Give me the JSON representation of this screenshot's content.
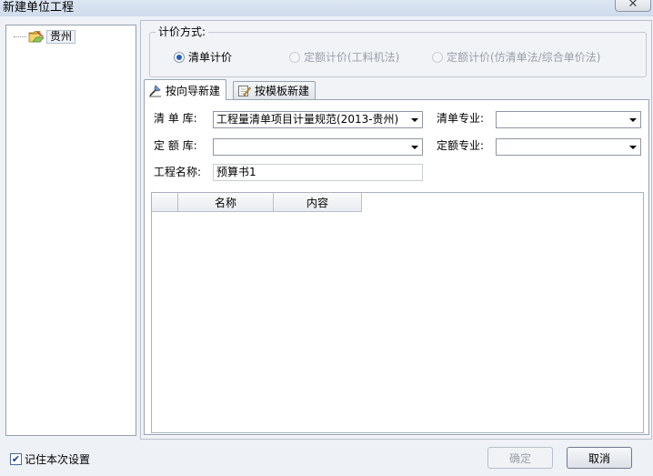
{
  "window": {
    "title": "新建单位工程",
    "close_glyph": "✕"
  },
  "tree": {
    "items": [
      {
        "label": "贵州",
        "icon": "folder-icon"
      }
    ]
  },
  "pricing": {
    "legend": "计价方式:",
    "options": [
      {
        "label": "清单计价",
        "checked": true,
        "enabled": true
      },
      {
        "label": "定额计价(工料机法)",
        "checked": false,
        "enabled": false
      },
      {
        "label": "定额计价(仿清单法/综合单价法)",
        "checked": false,
        "enabled": false
      }
    ]
  },
  "tabs": [
    {
      "label": "按向导新建",
      "icon": "wizard-icon",
      "active": true
    },
    {
      "label": "按模板新建",
      "icon": "template-icon",
      "active": false
    }
  ],
  "form": {
    "bill_lib_label": "清 单 库:",
    "bill_lib_value": "工程量清单项目计量规范(2013-贵州)",
    "bill_major_label": "清单专业:",
    "bill_major_value": "",
    "quota_lib_label": "定 额 库:",
    "quota_lib_value": "",
    "quota_major_label": "定额专业:",
    "quota_major_value": "",
    "project_name_label": "工程名称:",
    "project_name_value": "预算书1"
  },
  "grid": {
    "columns": [
      "",
      "名称",
      "内容"
    ]
  },
  "footer": {
    "remember_label": "记住本次设置",
    "remember_checked": true,
    "ok_label": "确定",
    "cancel_label": "取消"
  }
}
